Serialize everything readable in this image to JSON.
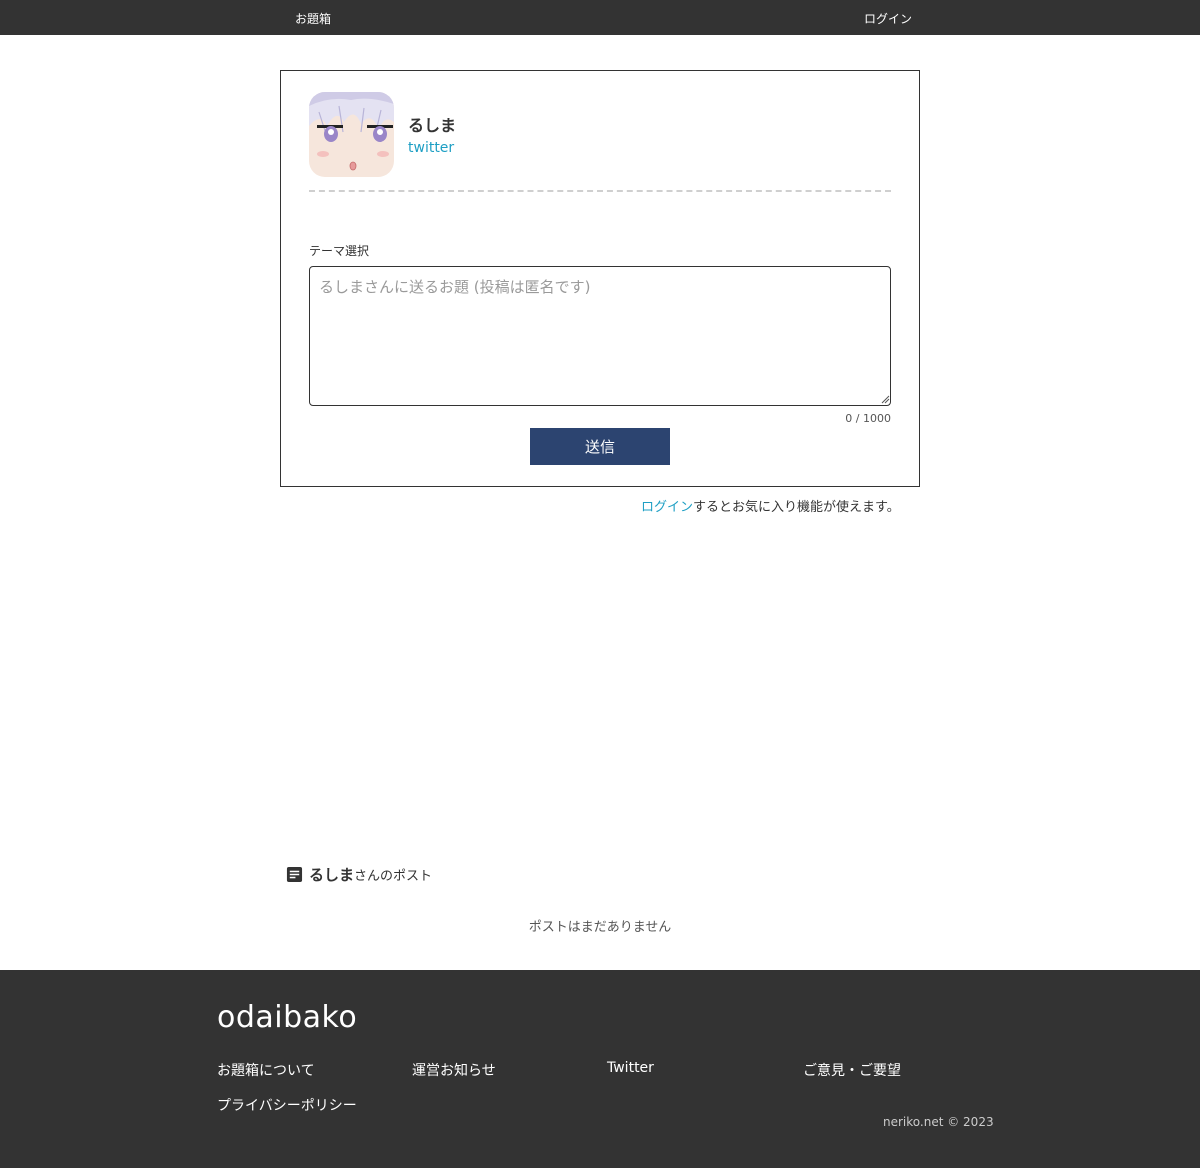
{
  "header": {
    "brand": "お題箱",
    "login": "ログイン"
  },
  "profile": {
    "name": "るしま",
    "link_label": "twitter"
  },
  "form": {
    "theme_label": "テーマ選択",
    "placeholder": "るしまさんに送るお題 (投稿は匿名です)",
    "value": "",
    "counter": "0 / 1000",
    "submit": "送信"
  },
  "login_note": {
    "link": "ログイン",
    "text": "するとお気に入り機能が使えます。"
  },
  "posts": {
    "user_name": "るしま",
    "suffix": "さんのポスト",
    "empty": "ポストはまだありません"
  },
  "footer": {
    "logo": "odaibako",
    "links": [
      "お題箱について",
      "運営お知らせ",
      "Twitter",
      "ご意見・ご要望",
      "プライバシーポリシー"
    ],
    "copyright": "neriko.net © 2023"
  },
  "colors": {
    "bar": "#333333",
    "accent_link": "#1e9fc4",
    "button": "#2c4470"
  }
}
